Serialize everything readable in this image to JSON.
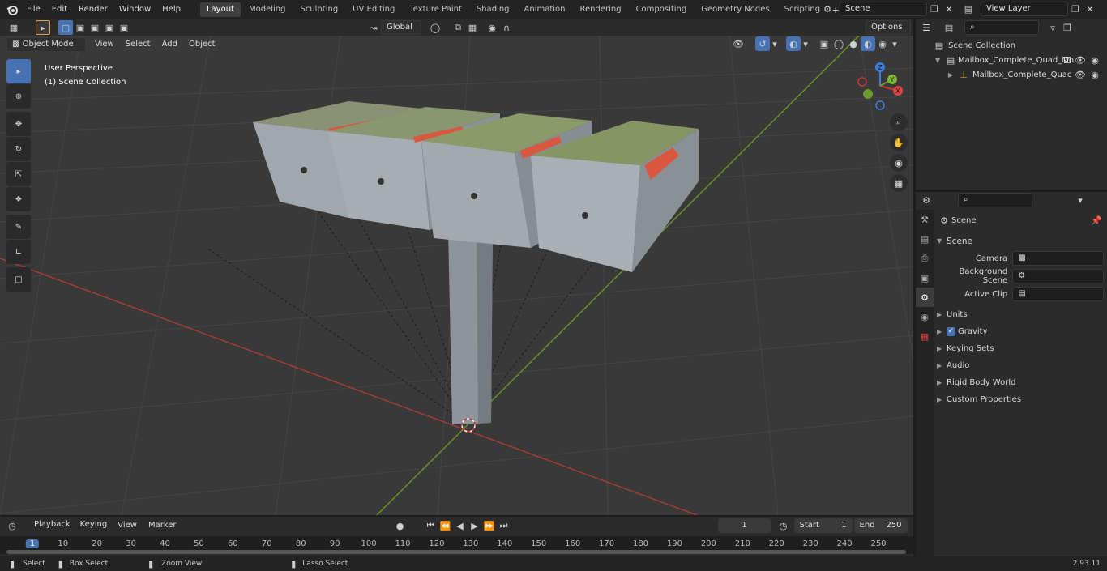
{
  "menus": [
    "File",
    "Edit",
    "Render",
    "Window",
    "Help"
  ],
  "workspaces": [
    "Layout",
    "Modeling",
    "Sculpting",
    "UV Editing",
    "Texture Paint",
    "Shading",
    "Animation",
    "Rendering",
    "Compositing",
    "Geometry Nodes",
    "Scripting"
  ],
  "scene_name": "Scene",
  "view_layer": "View Layer",
  "header": {
    "orientation": "Global",
    "options": "Options"
  },
  "viewport_header": {
    "mode": "Object Mode",
    "menus": [
      "View",
      "Select",
      "Add",
      "Object"
    ]
  },
  "viewport": {
    "perspective": "User Perspective",
    "collection": "(1) Scene Collection"
  },
  "outliner": {
    "root": "Scene Collection",
    "items": [
      "Mailbox_Complete_Quad_Mo",
      "Mailbox_Complete_Quac"
    ]
  },
  "properties": {
    "context": "Scene",
    "section": "Scene",
    "fields": [
      {
        "label": "Camera",
        "value": ""
      },
      {
        "label": "Background Scene",
        "value": ""
      },
      {
        "label": "Active Clip",
        "value": ""
      }
    ],
    "subsections": [
      "Units",
      "Gravity",
      "Keying Sets",
      "Audio",
      "Rigid Body World",
      "Custom Properties"
    ]
  },
  "timeline": {
    "menus": [
      "Playback",
      "Keying",
      "View",
      "Marker"
    ],
    "current_frame": "1",
    "start_label": "Start",
    "start": "1",
    "end_label": "End",
    "end": "250",
    "ruler": [
      "1",
      "10",
      "20",
      "30",
      "40",
      "50",
      "60",
      "70",
      "80",
      "90",
      "100",
      "110",
      "120",
      "130",
      "140",
      "150",
      "160",
      "170",
      "180",
      "190",
      "200",
      "210",
      "220",
      "230",
      "240",
      "250"
    ]
  },
  "statusbar": {
    "items": [
      "Select",
      "Box Select",
      "Zoom View",
      "Lasso Select"
    ],
    "version": "2.93.11"
  },
  "gizmo": {
    "x": "X",
    "y": "Y",
    "z": "Z"
  },
  "colors": {
    "accent": "#4772b3",
    "flag": "#d9573f",
    "x_axis": "#b33a3a",
    "y_axis": "#6b8e23"
  }
}
